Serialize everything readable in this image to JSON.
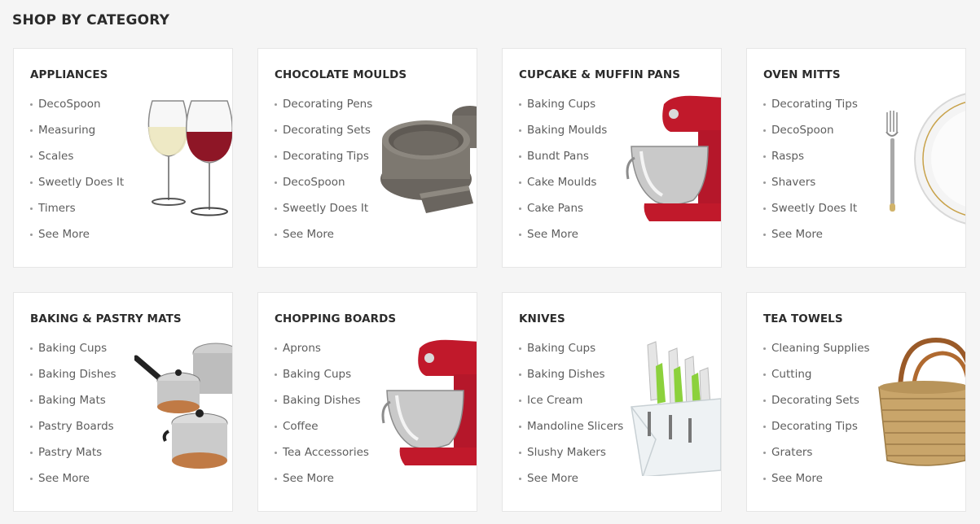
{
  "section": {
    "title": "SHOP BY CATEGORY"
  },
  "categories": [
    {
      "title": "APPLIANCES",
      "items": [
        "DecoSpoon",
        "Measuring",
        "Scales",
        "Sweetly Does It",
        "Timers",
        "See More"
      ],
      "image": "wine-glasses"
    },
    {
      "title": "CHOCOLATE MOULDS",
      "items": [
        "Decorating Pens",
        "Decorating Sets",
        "Decorating Tips",
        "DecoSpoon",
        "Sweetly Does It",
        "See More"
      ],
      "image": "springform-pans"
    },
    {
      "title": "CUPCAKE & MUFFIN PANS",
      "items": [
        "Baking Cups",
        "Baking Moulds",
        "Bundt Pans",
        "Cake Moulds",
        "Cake Pans",
        "See More"
      ],
      "image": "stand-mixer"
    },
    {
      "title": "OVEN MITTS",
      "items": [
        "Decorating Tips",
        "DecoSpoon",
        "Rasps",
        "Shavers",
        "Sweetly Does It",
        "See More"
      ],
      "image": "fork-and-plate"
    },
    {
      "title": "BAKING & PASTRY MATS",
      "items": [
        "Baking Cups",
        "Baking Dishes",
        "Baking Mats",
        "Pastry Boards",
        "Pastry Mats",
        "See More"
      ],
      "image": "cookware-pots"
    },
    {
      "title": "CHOPPING BOARDS",
      "items": [
        "Aprons",
        "Baking Cups",
        "Baking Dishes",
        "Coffee",
        "Tea Accessories",
        "See More"
      ],
      "image": "stand-mixer"
    },
    {
      "title": "KNIVES",
      "items": [
        "Baking Cups",
        "Baking Dishes",
        "Ice Cream",
        "Mandoline Slicers",
        "Slushy Makers",
        "See More"
      ],
      "image": "knife-block"
    },
    {
      "title": "TEA TOWELS",
      "items": [
        "Cleaning Supplies",
        "Cutting",
        "Decorating Sets",
        "Decorating Tips",
        "Graters",
        "See More"
      ],
      "image": "wicker-basket"
    }
  ]
}
